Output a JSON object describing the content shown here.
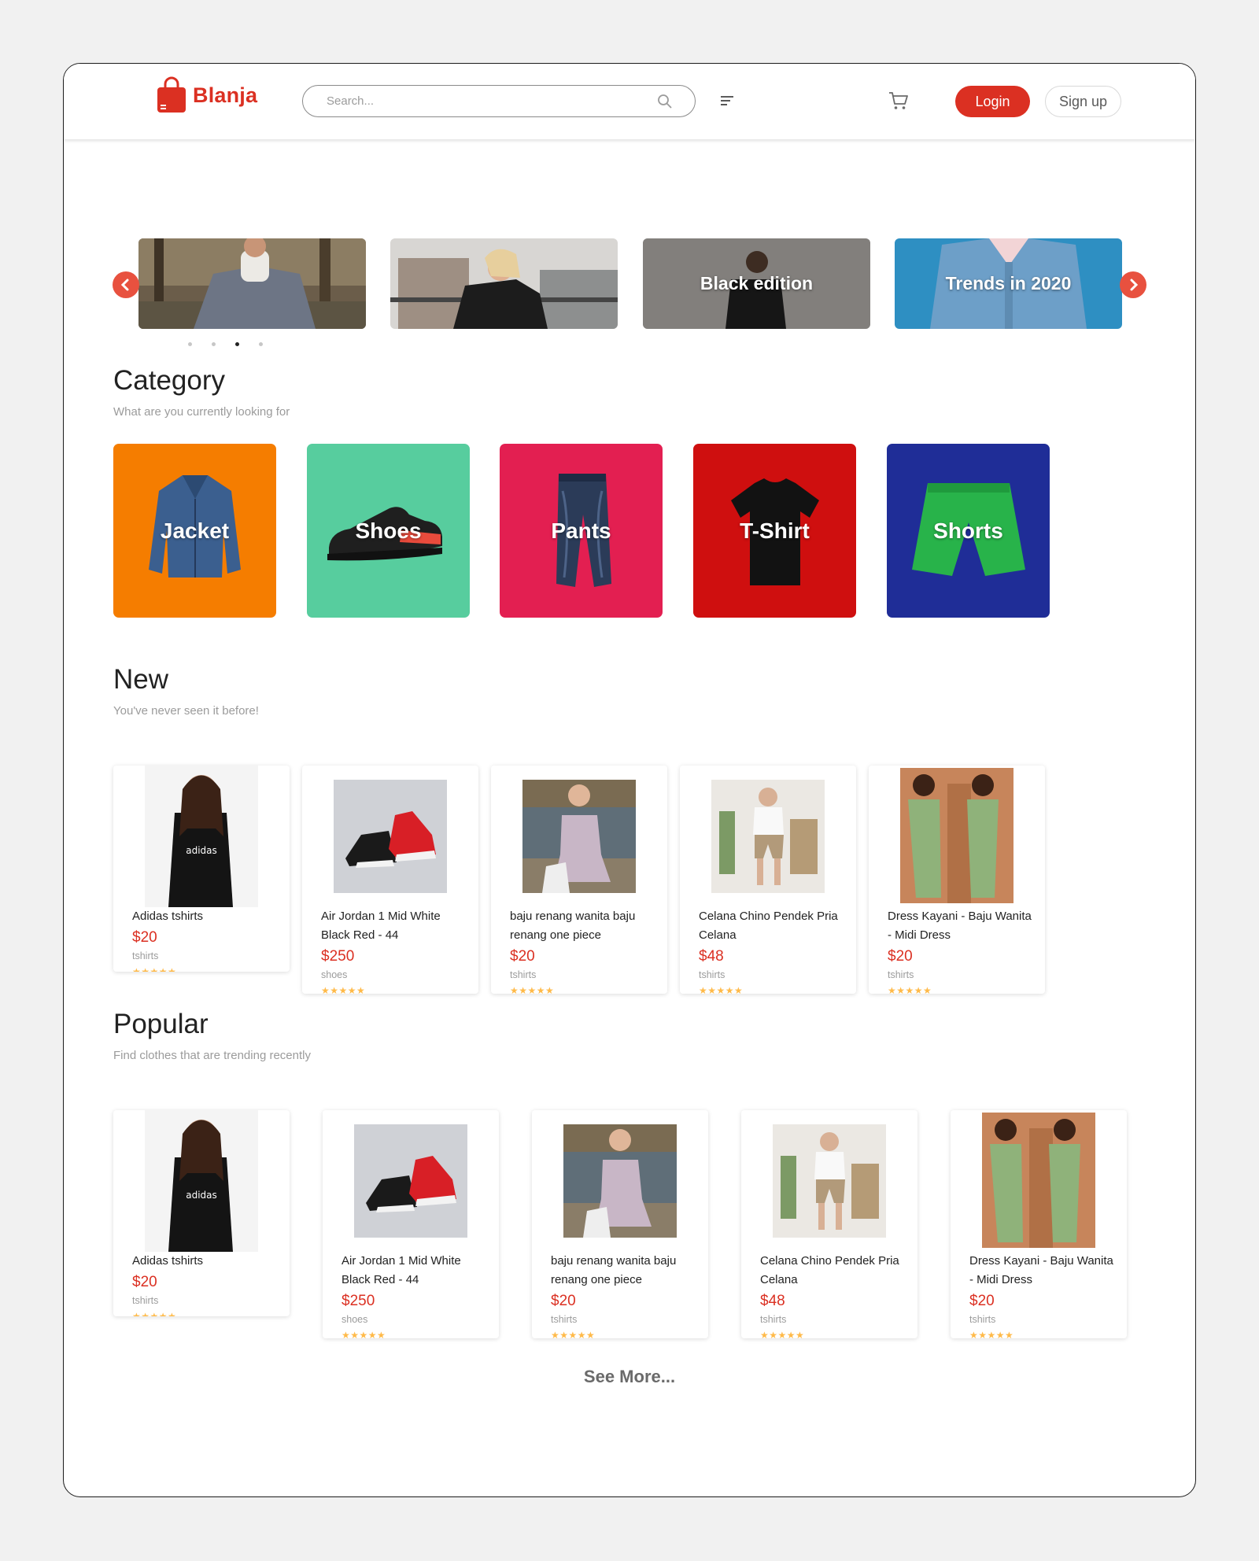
{
  "brand": {
    "name": "Blanja",
    "color": "#db3022"
  },
  "header": {
    "search_placeholder": "Search...",
    "login_label": "Login",
    "signup_label": "Sign up"
  },
  "carousel": {
    "slides": [
      {
        "title": "",
        "image": "man-in-blazer-photo"
      },
      {
        "title": "",
        "image": "woman-black-tshirt-photo"
      },
      {
        "title": "Black edition",
        "image": "man-black-tshirt-photo"
      },
      {
        "title": "Trends in 2020",
        "image": "denim-jacket-photo"
      }
    ],
    "active_dot": 3,
    "dot_count": 4
  },
  "category": {
    "title": "Category",
    "subtitle": "What are you currently looking for",
    "items": [
      {
        "label": "Jacket",
        "color": "#f57d00",
        "icon": "jacket-image"
      },
      {
        "label": "Shoes",
        "color": "#57cd9e",
        "icon": "sneaker-image"
      },
      {
        "label": "Pants",
        "color": "#e31f51",
        "icon": "jeans-image"
      },
      {
        "label": "T-Shirt",
        "color": "#cf0f0f",
        "icon": "tshirt-image"
      },
      {
        "label": "Shorts",
        "color": "#1f2d97",
        "icon": "shorts-image"
      }
    ]
  },
  "new": {
    "title": "New",
    "subtitle": "You've never seen it before!",
    "products": [
      {
        "name": "Adidas tshirts",
        "price": "$20",
        "category": "tshirts",
        "stars": "★★★★★",
        "image": "adidas-tshirt-photo"
      },
      {
        "name": "Air Jordan 1 Mid White Black Red - 44",
        "price": "$250",
        "category": "shoes",
        "stars": "★★★★★",
        "image": "air-jordan-photo"
      },
      {
        "name": "baju renang wanita baju renang one piece",
        "price": "$20",
        "category": "tshirts",
        "stars": "★★★★★",
        "image": "swimsuit-photo"
      },
      {
        "name": "Celana Chino Pendek Pria Celana",
        "price": "$48",
        "category": "tshirts",
        "stars": "★★★★★",
        "image": "chino-shorts-photo"
      },
      {
        "name": "Dress Kayani - Baju Wanita - Midi Dress",
        "price": "$20",
        "category": "tshirts",
        "stars": "★★★★★",
        "image": "midi-dress-photo"
      }
    ]
  },
  "popular": {
    "title": "Popular",
    "subtitle": "Find clothes that are trending recently",
    "products": [
      {
        "name": "Adidas tshirts",
        "price": "$20",
        "category": "tshirts",
        "stars": "★★★★★",
        "image": "adidas-tshirt-photo"
      },
      {
        "name": "Air Jordan 1 Mid White Black Red - 44",
        "price": "$250",
        "category": "shoes",
        "stars": "★★★★★",
        "image": "air-jordan-photo"
      },
      {
        "name": "baju renang wanita baju renang one piece",
        "price": "$20",
        "category": "tshirts",
        "stars": "★★★★★",
        "image": "swimsuit-photo"
      },
      {
        "name": "Celana Chino Pendek Pria Celana",
        "price": "$48",
        "category": "tshirts",
        "stars": "★★★★★",
        "image": "chino-shorts-photo"
      },
      {
        "name": "Dress Kayani - Baju Wanita - Midi Dress",
        "price": "$20",
        "category": "tshirts",
        "stars": "★★★★★",
        "image": "midi-dress-photo"
      }
    ]
  },
  "see_more_label": "See More..."
}
